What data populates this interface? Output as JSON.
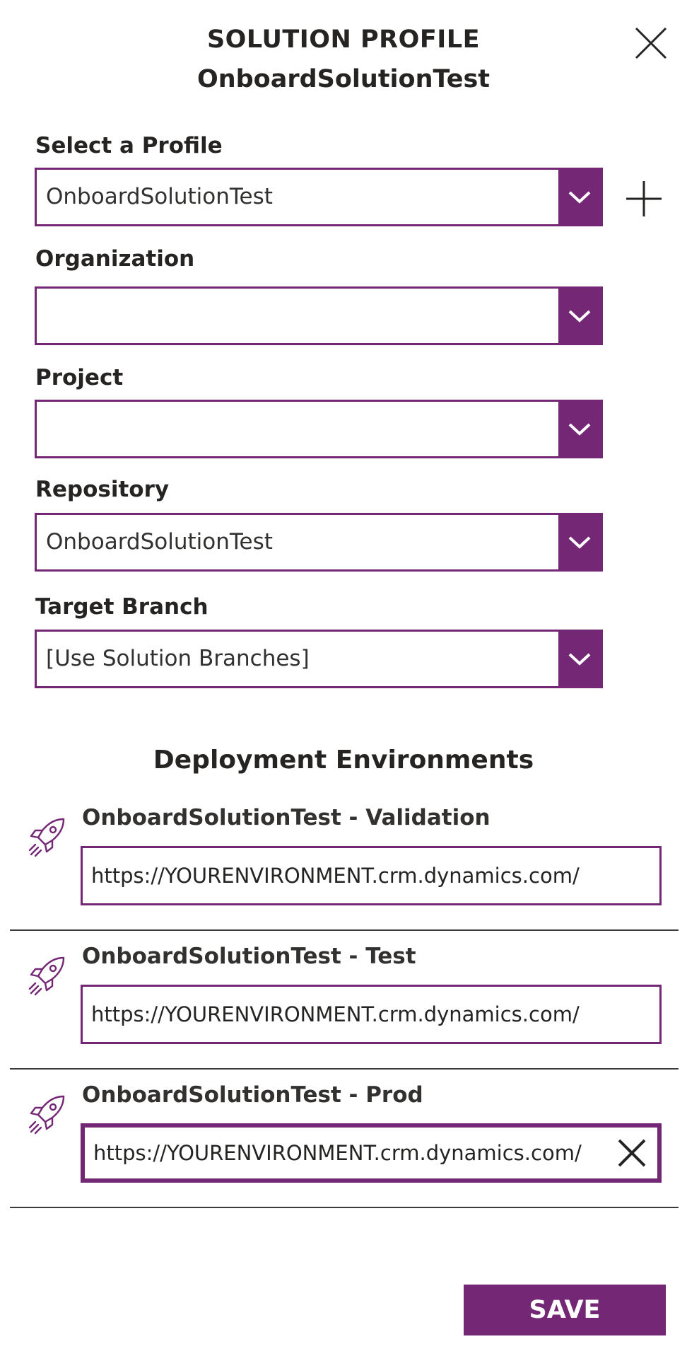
{
  "header": {
    "title": "SOLUTION PROFILE",
    "subtitle": "OnboardSolutionTest"
  },
  "fields": {
    "profile": {
      "label": "Select a Profile",
      "value": "OnboardSolutionTest"
    },
    "organization": {
      "label": "Organization",
      "value": ""
    },
    "project": {
      "label": "Project",
      "value": ""
    },
    "repository": {
      "label": "Repository",
      "value": "OnboardSolutionTest"
    },
    "target_branch": {
      "label": "Target Branch",
      "value": "[Use Solution Branches]"
    }
  },
  "deployment": {
    "title": "Deployment Environments",
    "environments": [
      {
        "label": "OnboardSolutionTest - Validation",
        "url": "https://YOURENVIRONMENT.crm.dynamics.com/"
      },
      {
        "label": "OnboardSolutionTest - Test",
        "url": "https://YOURENVIRONMENT.crm.dynamics.com/"
      },
      {
        "label": "OnboardSolutionTest - Prod",
        "url": "https://YOURENVIRONMENT.crm.dynamics.com/"
      }
    ]
  },
  "actions": {
    "save_label": "SAVE"
  },
  "icons": {
    "close": "close-icon",
    "add": "plus-icon",
    "chevron": "chevron-down-icon",
    "environment": "rocket-icon",
    "clear": "clear-icon"
  },
  "colors": {
    "accent": "#742774",
    "text": "#252423",
    "divider": "#3b3a39"
  }
}
